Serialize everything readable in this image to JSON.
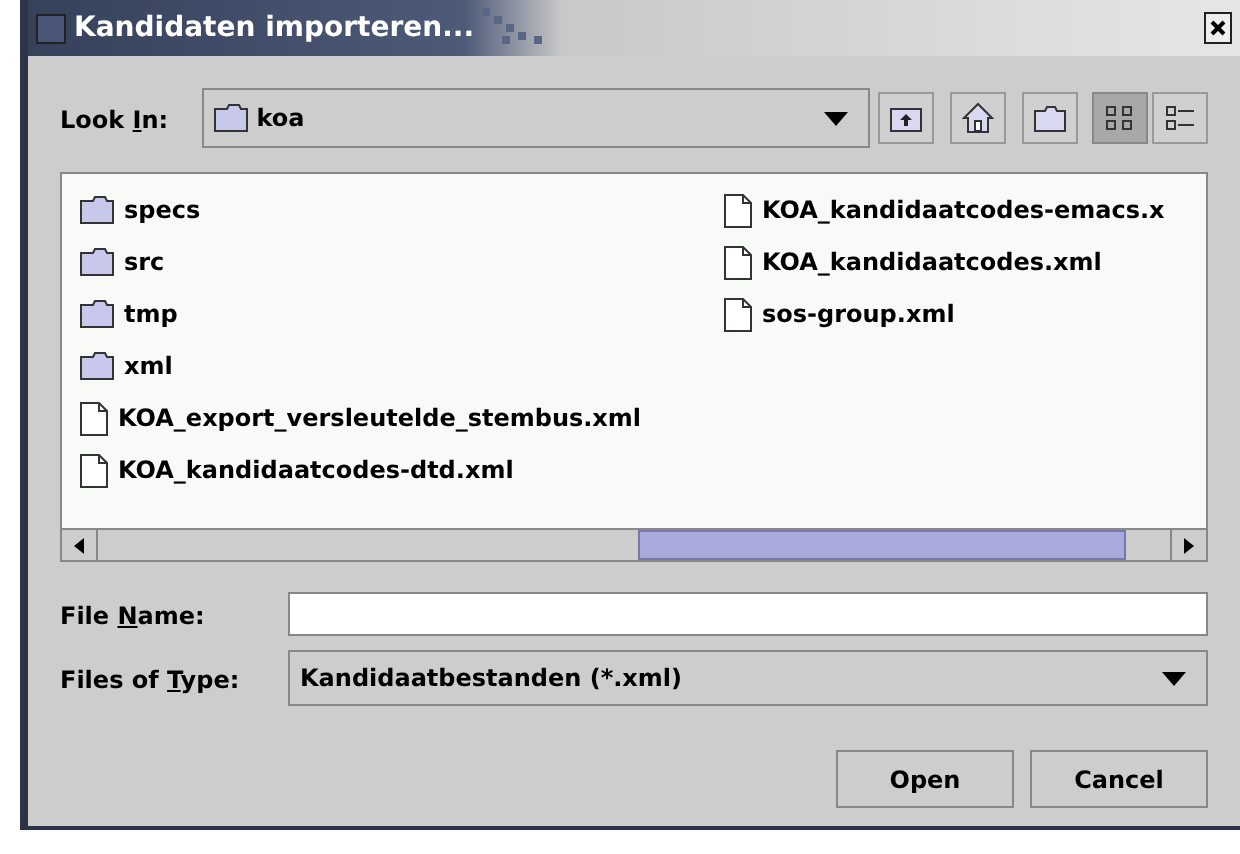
{
  "window": {
    "title": "Kandidaten importeren..."
  },
  "look_in": {
    "label_parts": [
      "Look ",
      "I",
      "n:"
    ],
    "value": "koa"
  },
  "toolbar": [
    {
      "kind": "up",
      "selected": false
    },
    {
      "kind": "home",
      "selected": false
    },
    {
      "kind": "new-folder",
      "selected": false
    },
    {
      "kind": "list",
      "selected": true
    },
    {
      "kind": "details",
      "selected": false
    }
  ],
  "files": [
    [
      {
        "name": "specs",
        "kind": "folder"
      },
      {
        "name": "src",
        "kind": "folder"
      },
      {
        "name": "tmp",
        "kind": "folder"
      },
      {
        "name": "xml",
        "kind": "folder"
      },
      {
        "name": "KOA_export_versleutelde_stembus.xml",
        "kind": "file"
      },
      {
        "name": "KOA_kandidaatcodes-dtd.xml",
        "kind": "file"
      }
    ],
    [
      {
        "name": "KOA_kandidaatcodes-emacs.x",
        "kind": "file"
      },
      {
        "name": "KOA_kandidaatcodes.xml",
        "kind": "file"
      },
      {
        "name": "sos-group.xml",
        "kind": "file"
      }
    ]
  ],
  "file_name": {
    "label_parts": [
      "File ",
      "N",
      "ame:"
    ]
  },
  "files_of_type": {
    "label_parts": [
      "Files of ",
      "T",
      "ype:"
    ],
    "value": "Kandidaatbestanden (*.xml)"
  },
  "buttons": [
    "Open",
    "Cancel"
  ]
}
